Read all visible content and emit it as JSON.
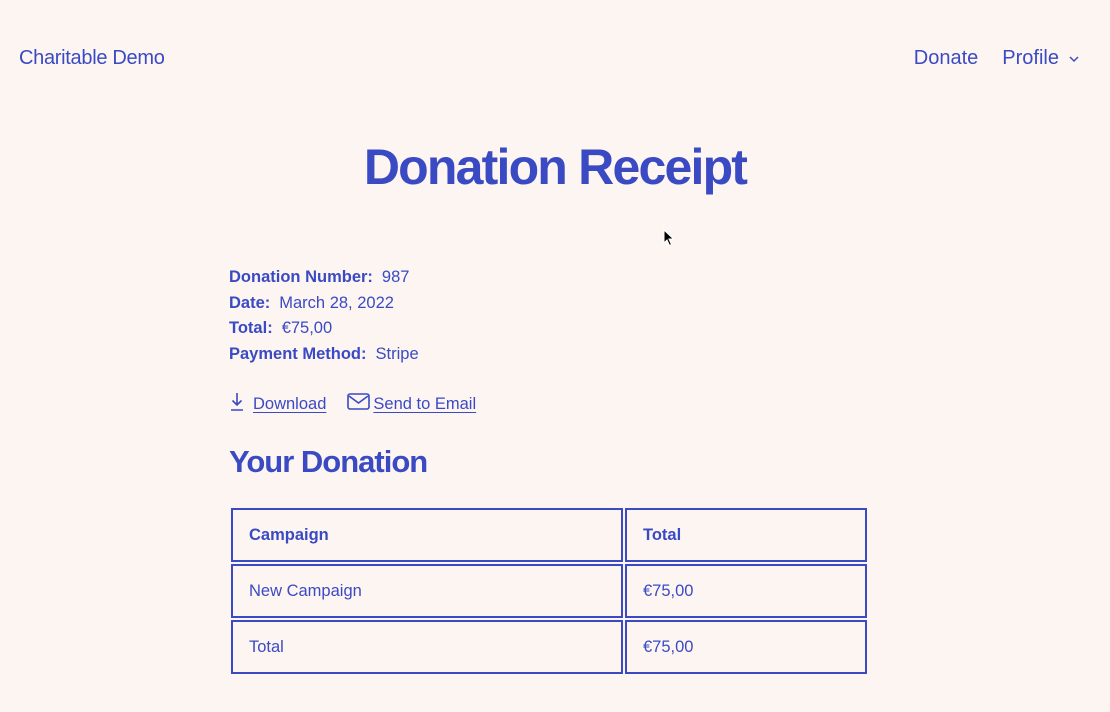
{
  "header": {
    "site_title": "Charitable Demo",
    "nav": {
      "donate_label": "Donate",
      "profile_label": "Profile"
    }
  },
  "page": {
    "title": "Donation Receipt"
  },
  "details": [
    {
      "label": "Donation Number:",
      "value": "987"
    },
    {
      "label": "Date:",
      "value": "March 28, 2022"
    },
    {
      "label": "Total:",
      "value": "€75,00"
    },
    {
      "label": "Payment Method:",
      "value": "Stripe"
    }
  ],
  "actions": {
    "download_label": "Download",
    "email_label": "Send to Email"
  },
  "section": {
    "title": "Your Donation"
  },
  "table": {
    "headers": [
      "Campaign",
      "Total"
    ],
    "rows": [
      [
        "New Campaign",
        "€75,00"
      ],
      [
        "Total",
        "€75,00"
      ]
    ]
  },
  "icons": {
    "chevron": "chevron-down-icon",
    "download": "download-icon",
    "email": "envelope-icon",
    "cursor": "mouse-pointer-icon"
  },
  "colors": {
    "accent": "#3a4ac3",
    "background": "#fdf5f2"
  }
}
